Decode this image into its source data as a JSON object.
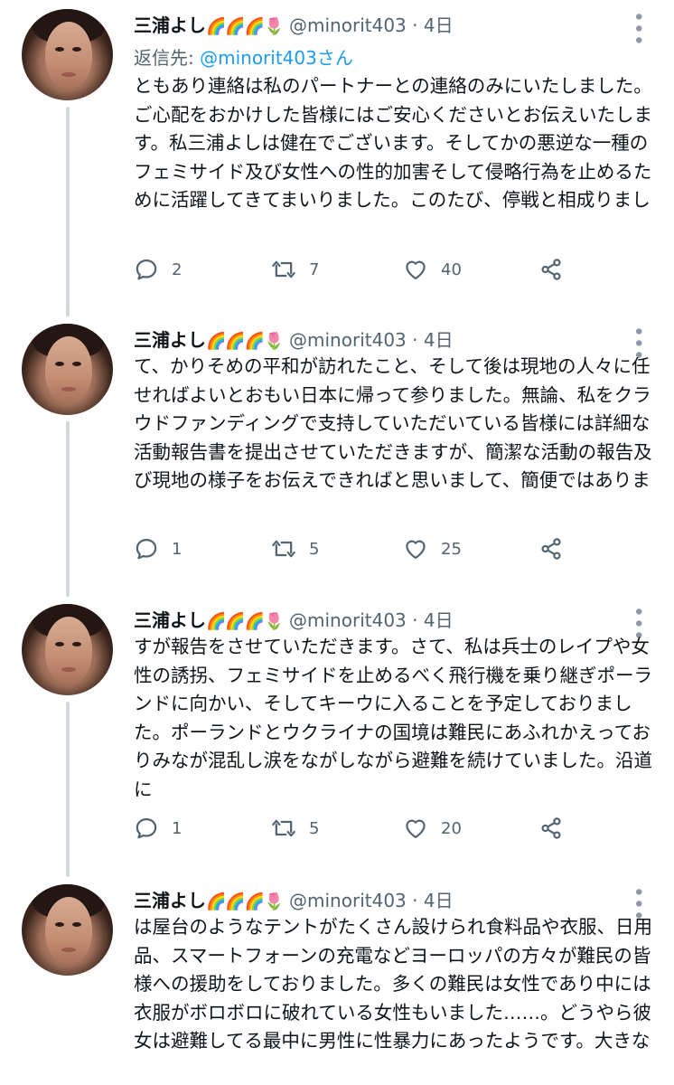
{
  "tweets": [
    {
      "name": "三浦よし",
      "emojis": "🌈🌈🌈🌷",
      "handle": "@minorit403",
      "dot": "·",
      "time": "4日",
      "reply_prefix": "返信先: ",
      "reply_mention": "@minorit403さん",
      "text": "ともあり連絡は私のパートナーとの連絡のみにいたしました。ご心配をおかけした皆様にはご安心くださいとお伝えいたします。私三浦よしは健在でございます。そしてかの悪逆な一種のフェミサイド及び女性への性的加害そして侵略行為を止めるために活躍してきてまいりました。このたび、停戦と相成りまし",
      "replies": "2",
      "retweets": "7",
      "likes": "40"
    },
    {
      "name": "三浦よし",
      "emojis": "🌈🌈🌈🌷",
      "handle": "@minorit403",
      "dot": "·",
      "time": "4日",
      "text": "て、かりそめの平和が訪れたこと、そして後は現地の人々に任せればよいとおもい日本に帰って参りました。無論、私をクラウドファンディングで支持していただいている皆様には詳細な活動報告書を提出させていただきますが、簡潔な活動の報告及び現地の様子をお伝えできればと思いまして、簡便ではありま",
      "replies": "1",
      "retweets": "5",
      "likes": "25"
    },
    {
      "name": "三浦よし",
      "emojis": "🌈🌈🌈🌷",
      "handle": "@minorit403",
      "dot": "·",
      "time": "4日",
      "text": "すが報告をさせていただきます。さて、私は兵士のレイプや女性の誘拐、フェミサイドを止めるべく飛行機を乗り継ぎポーランドに向かい、そしてキーウに入ることを予定しておりました。ポーランドとウクライナの国境は難民にあふれかえっておりみなが混乱し涙をながしながら避難を続けていました。沿道に",
      "replies": "1",
      "retweets": "5",
      "likes": "20"
    },
    {
      "name": "三浦よし",
      "emojis": "🌈🌈🌈🌷",
      "handle": "@minorit403",
      "dot": "·",
      "time": "4日",
      "text": "は屋台のようなテントがたくさん設けられ食料品や衣服、日用品、スマートフォーンの充電などヨーロッパの方々が難民の皆様への援助をしておりました。多くの難民は女性であり中には衣服がボロボロに破れている女性もいました……。どうやら彼女は避難してる最中に男性に性暴力にあったようです。大きな"
    }
  ],
  "icons": [
    "reply-icon",
    "retweet-icon",
    "like-icon",
    "share-icon",
    "more-icon"
  ],
  "colors": {
    "text": "#0f1419",
    "secondary": "#536471",
    "link": "#1d9bf0",
    "thread_line": "#cfd9de"
  }
}
